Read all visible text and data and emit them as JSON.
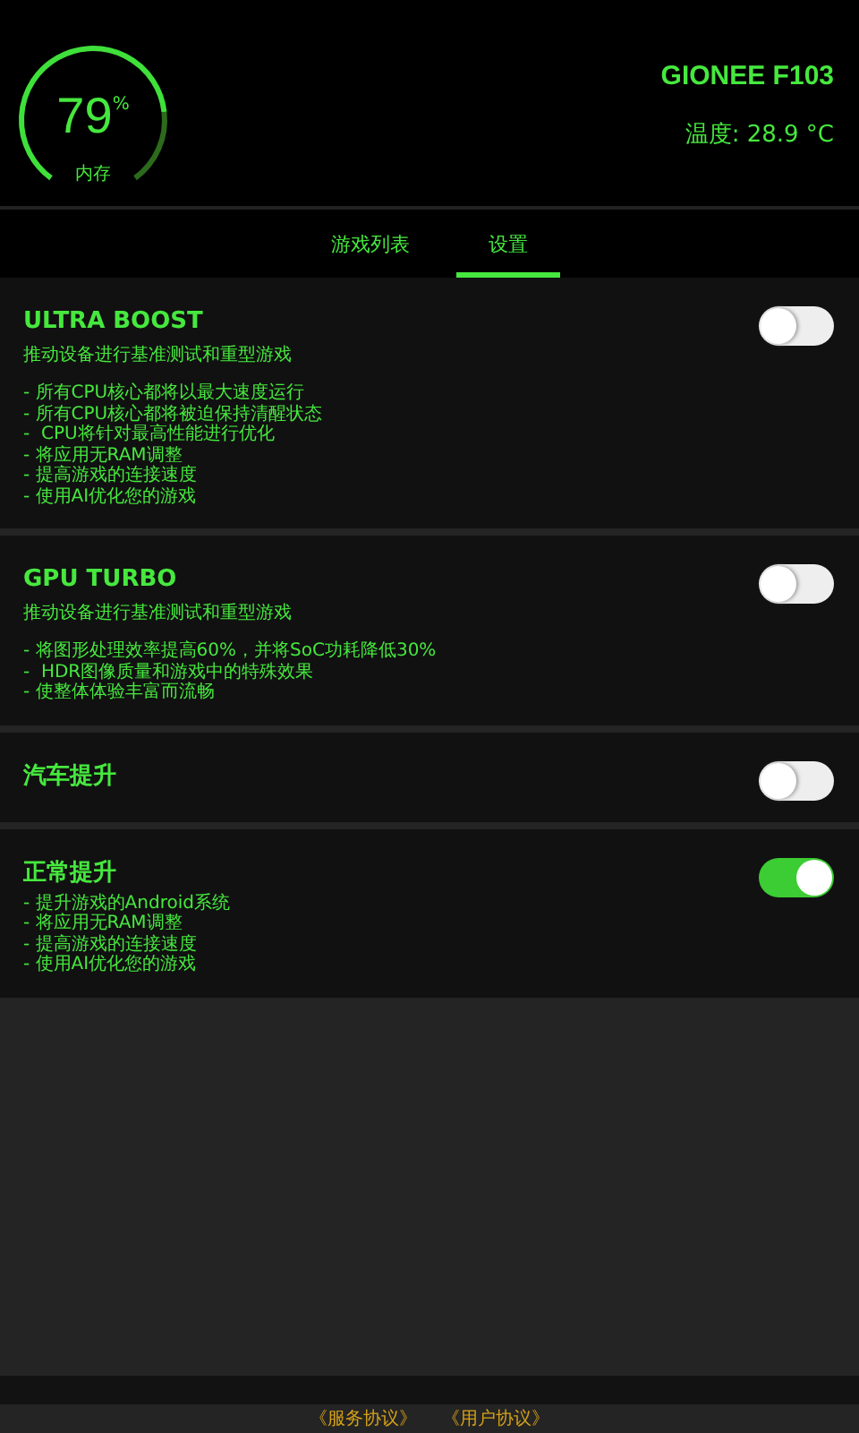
{
  "header": {
    "memory": {
      "value": "79",
      "unit": "%",
      "label": "内存"
    },
    "device": "GIONEE F103",
    "temperature": "温度: 28.9 °C"
  },
  "tabs": [
    {
      "label": "游戏列表",
      "selected": false
    },
    {
      "label": "设置",
      "selected": true
    }
  ],
  "boosts": [
    {
      "title": "ULTRA BOOST",
      "on": false,
      "description": "推动设备进行基准测试和重型游戏",
      "bullets": [
        "- 所有CPU核心都将以最大速度运行",
        "- 所有CPU核心都将被迫保持清醒状态",
        "-  CPU将针对最高性能进行优化",
        "- 将应用无RAM调整",
        "- 提高游戏的连接速度",
        "- 使用AI优化您的游戏"
      ]
    },
    {
      "title": "GPU TURBO",
      "on": false,
      "description": "推动设备进行基准测试和重型游戏",
      "bullets": [
        "- 将图形处理效率提高60%，并将SoC功耗降低30%",
        "-  HDR图像质量和游戏中的特殊效果",
        "- 使整体体验丰富而流畅"
      ]
    },
    {
      "title": "汽车提升",
      "on": false
    },
    {
      "title": "正常提升",
      "on": true,
      "bullets": [
        "- 提升游戏的Android系统",
        "- 将应用无RAM调整",
        "- 提高游戏的连接速度",
        "- 使用AI优化您的游戏"
      ]
    }
  ],
  "footer_links": [
    "《服务协议》",
    "《用户协议》"
  ]
}
